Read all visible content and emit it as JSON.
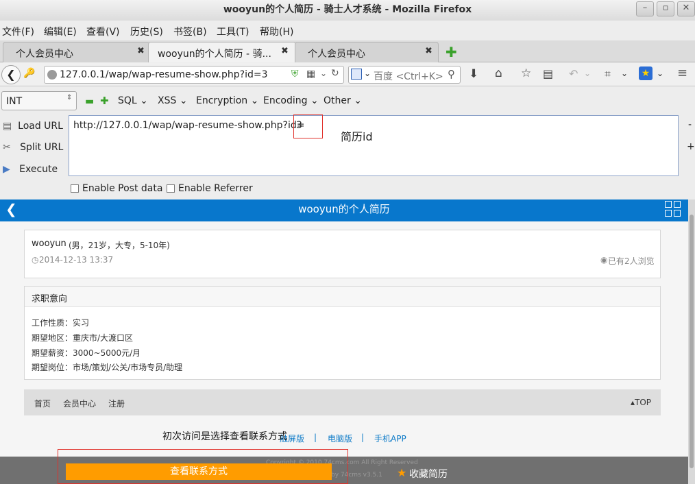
{
  "window": {
    "title": "wooyun的个人简历 - 骑士人才系统 - Mozilla Firefox"
  },
  "menubar": [
    "文件(F)",
    "编辑(E)",
    "查看(V)",
    "历史(S)",
    "书签(B)",
    "工具(T)",
    "帮助(H)"
  ],
  "tabs": [
    {
      "label": "个人会员中心"
    },
    {
      "label": "wooyun的个人简历 - 骑..."
    },
    {
      "label": "个人会员中心"
    }
  ],
  "nav": {
    "url": "127.0.0.1/wap/wap-resume-show.php?id=3",
    "search_placeholder": "百度 <Ctrl+K>"
  },
  "hackbar": {
    "select": "INT",
    "menus": [
      "SQL",
      "XSS",
      "Encryption",
      "Encoding",
      "Other"
    ],
    "load": "Load URL",
    "split": "Split URL",
    "execute": "Execute",
    "url_text": "http://127.0.0.1/wap/wap-resume-show.php?id=",
    "url_id": "3",
    "annotation": "简历id",
    "enable_post": "Enable Post data",
    "enable_referrer": "Enable Referrer",
    "minus": "-",
    "plus": "+"
  },
  "page": {
    "header_title": "wooyun的个人简历",
    "name": "wooyun",
    "name_info": "(男，21岁，大专，5-10年)",
    "date": "2014-12-13 13:37",
    "views": "已有2人浏览",
    "section_title": "求职意向",
    "fields": [
      "工作性质：实习",
      "期望地区：重庆市/大渡口区",
      "期望薪资：3000~5000元/月",
      "期望岗位：市场/策划/公关/市场专员/助理"
    ],
    "footer_nav": [
      "首页",
      "会员中心",
      "注册"
    ],
    "top": "TOP",
    "annotation": "初次访问是选择查看联系方式",
    "links": [
      "触屏版",
      "|",
      "电脑版",
      "|",
      "手机APP"
    ],
    "copyright": "Copyright © 2010 74cms.com All Right Reserved",
    "powered": "by 74cms v3.5.1",
    "contact_btn": "查看联系方式",
    "favorite": "收藏简历"
  }
}
